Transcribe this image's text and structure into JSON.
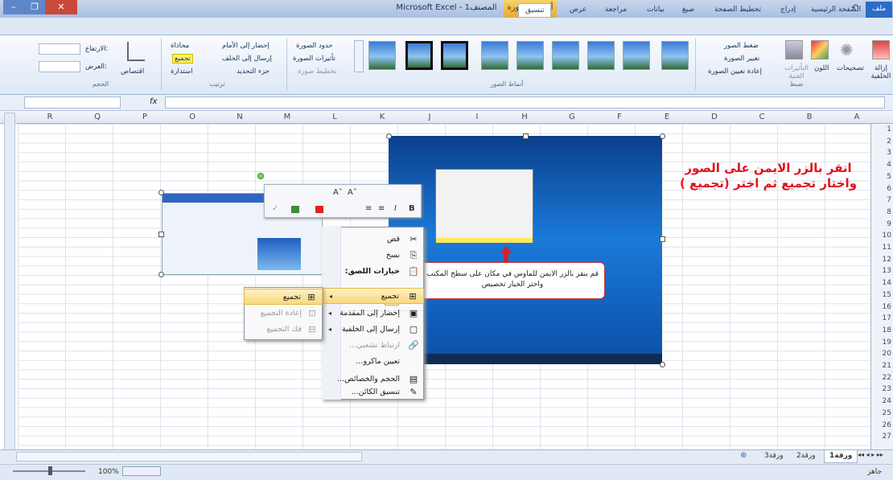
{
  "window": {
    "title": "Microsoft Excel - المصنف1",
    "context_tab": "أدوات الصورة"
  },
  "tabs": [
    "ملف",
    "الصفحة الرئيسية",
    "إدراج",
    "تخطيط الصفحة",
    "صيغ",
    "بيانات",
    "مراجعة",
    "عرض",
    "تنسيق"
  ],
  "active_tab": "تنسيق",
  "ribbon": {
    "adjust": {
      "label": "ضبط",
      "remove_bg": "إزالة الخلفية",
      "corrections": "تصحيحات",
      "color": "اللون",
      "effects": "التأثيرات الفنية",
      "compress": "ضغط الصور",
      "change": "تغيير الصورة",
      "reset": "إعادة تعيين الصورة"
    },
    "styles": {
      "label": "أنماط الصور",
      "border": "حدود الصورة",
      "effects": "تأثيرات الصورة",
      "layout": "تخطيط صورة"
    },
    "arrange": {
      "label": "ترتيب",
      "bring_forward": "إحضار إلى الأمام",
      "send_backward": "إرسال إلى الخلف",
      "selection_pane": "جزء التحديد",
      "align": "محاذاة",
      "group": "تجميع",
      "rotate": "استدارة"
    },
    "size": {
      "label": "الحجم",
      "crop": "اقتصاص",
      "height": "الارتفاع:",
      "width": "العرض:"
    }
  },
  "formula_bar": {
    "fx": "fx"
  },
  "columns": [
    "A",
    "B",
    "C",
    "D",
    "E",
    "F",
    "G",
    "H",
    "I",
    "J",
    "K",
    "L",
    "M",
    "N",
    "O",
    "P",
    "Q",
    "R"
  ],
  "rows": [
    "1",
    "2",
    "3",
    "4",
    "5",
    "6",
    "7",
    "8",
    "9",
    "10",
    "11",
    "12",
    "13",
    "14",
    "15",
    "16",
    "17",
    "18",
    "19",
    "20",
    "21",
    "22",
    "23",
    "24",
    "25",
    "26",
    "27"
  ],
  "instruction_text": "انقر بالزر الايمن على الصور واختار تجميع ثم اختر (تجميع )",
  "callout_text": "قم بنقر بالزر الايمن للماوس في مكان على سطح المكتب واختر الخيار تخصيص",
  "context_menu": {
    "items": [
      {
        "label": "قص",
        "icon": "scissors-icon",
        "glyph": "✂",
        "disabled": false
      },
      {
        "label": "نسخ",
        "icon": "copy-icon",
        "glyph": "⎘",
        "disabled": false
      },
      {
        "label": "خيارات اللصق:",
        "icon": "paste-icon",
        "glyph": "📋",
        "disabled": false
      },
      {
        "label": "تجميع",
        "icon": "group-icon",
        "glyph": "⊞",
        "disabled": false
      },
      {
        "label": "إحضار إلى المقدمة",
        "icon": "bring-front-icon",
        "glyph": "▣",
        "disabled": false
      },
      {
        "label": "إرسال إلى الخلفية",
        "icon": "send-back-icon",
        "glyph": "▢",
        "disabled": false
      },
      {
        "label": "ارتباط تشعبي...",
        "icon": "hyperlink-icon",
        "glyph": "🔗",
        "disabled": true
      },
      {
        "label": "تعيين ماكرو...",
        "icon": "",
        "glyph": "",
        "disabled": false
      },
      {
        "label": "الحجم والخصائص...",
        "icon": "size-icon",
        "glyph": "▤",
        "disabled": false
      },
      {
        "label": "تنسيق الكائن...",
        "icon": "format-icon",
        "glyph": "✎",
        "disabled": false
      }
    ]
  },
  "submenu": {
    "items": [
      {
        "label": "تجميع",
        "icon": "group-icon",
        "glyph": "⊞",
        "disabled": false
      },
      {
        "label": "إعادة التجميع",
        "icon": "regroup-icon",
        "glyph": "⊡",
        "disabled": true
      },
      {
        "label": "فك التجميع",
        "icon": "ungroup-icon",
        "glyph": "⊟",
        "disabled": true
      }
    ]
  },
  "mini_toolbar": {
    "font_grow": "A˄",
    "font_shrink": "A˅",
    "bold": "B",
    "italic": "I"
  },
  "sheets": [
    "ورقة1",
    "ورقة2",
    "ورقة3"
  ],
  "active_sheet": "ورقة1",
  "status": {
    "ready": "جاهز",
    "zoom": "100%"
  }
}
